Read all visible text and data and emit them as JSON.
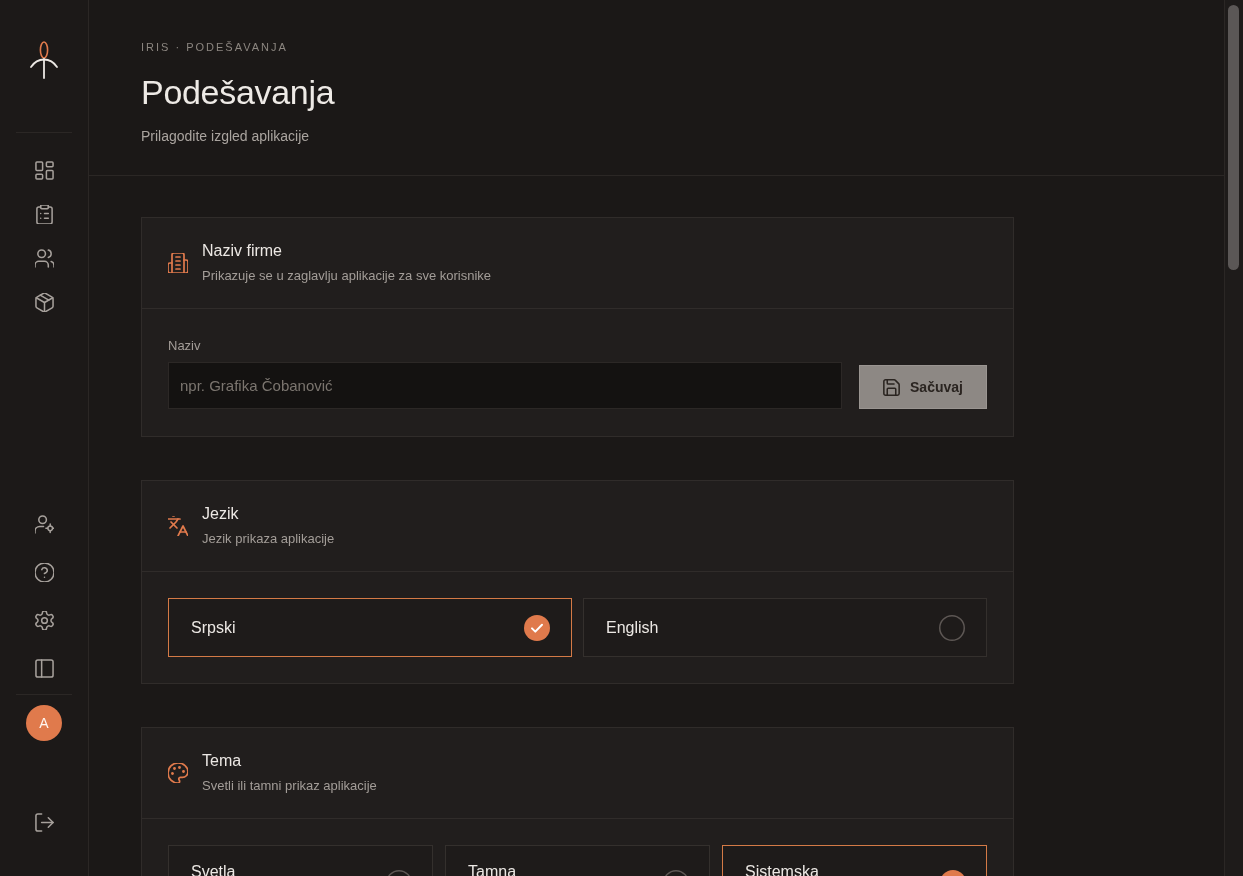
{
  "sidebar": {
    "avatar": "A"
  },
  "header": {
    "breadcrumb": "IRIS · PODEŠAVANJA",
    "title": "Podešavanja",
    "subtitle": "Prilagodite izgled aplikacije"
  },
  "sections": [
    {
      "kind": "text_field",
      "title": "Naziv firme",
      "description": "Prikazuje se u zaglavlju aplikacije za sve korisnike",
      "field": {
        "label": "Naziv",
        "placeholder": "npr. Grafika Čobanović"
      },
      "button": {
        "label": "Sačuvaj",
        "disabled": true
      }
    },
    {
      "kind": "choice_list",
      "title": "Jezik",
      "description": "Jezik prikaza aplikacije",
      "options": [
        {
          "label": "Srpski",
          "selected": true
        },
        {
          "label": "English",
          "selected": false
        }
      ]
    },
    {
      "kind": "choice_tiles",
      "title": "Tema",
      "description": "Svetli ili tamni prikaz aplikacije",
      "options": [
        {
          "label": "Svetla",
          "selected": false
        },
        {
          "label": "Tamna",
          "selected": false
        },
        {
          "label": "Sistemska",
          "selected": true
        }
      ]
    }
  ]
}
